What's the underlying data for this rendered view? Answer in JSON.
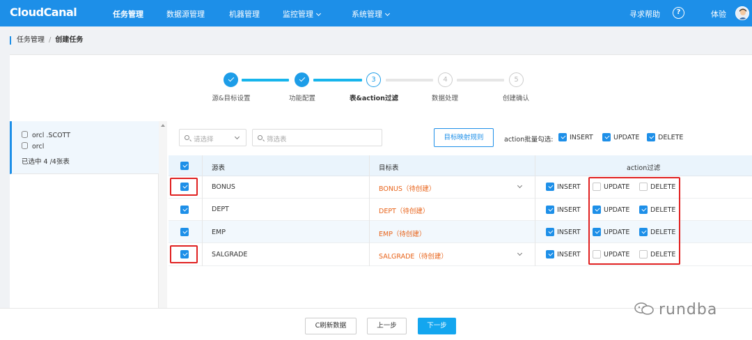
{
  "nav": {
    "logo": "CloudCanal",
    "items": [
      "任务管理",
      "数据源管理",
      "机器管理",
      "监控管理",
      "系统管理"
    ],
    "help": "寻求帮助",
    "help_icon": "?",
    "user": "体验"
  },
  "breadcrumb": {
    "parent": "任务管理",
    "separator": "/",
    "current": "创建任务"
  },
  "steps": [
    {
      "num": "1",
      "label": "源&目标设置",
      "state": "done"
    },
    {
      "num": "2",
      "label": "功能配置",
      "state": "done"
    },
    {
      "num": "3",
      "label": "表&action过滤",
      "state": "current"
    },
    {
      "num": "4",
      "label": "数据处理",
      "state": "todo"
    },
    {
      "num": "5",
      "label": "创建确认",
      "state": "todo"
    }
  ],
  "left": {
    "db1": "orcl .SCOTT",
    "db2": "orcl",
    "selected": "已选中 4 /4张表"
  },
  "toolbar": {
    "select_placeholder": "请选择",
    "filter_placeholder": "筛选表",
    "mapping_button": "目标映射规则",
    "batch_label": "action批量勾选:",
    "batch": [
      {
        "label": "INSERT",
        "checked": true
      },
      {
        "label": "UPDATE",
        "checked": true
      },
      {
        "label": "DELETE",
        "checked": true
      }
    ]
  },
  "table": {
    "headers": {
      "source": "源表",
      "target": "目标表",
      "action": "action过滤"
    },
    "rows": [
      {
        "source": "BONUS",
        "target": "BONUS（待创建）",
        "insert": true,
        "update": false,
        "delete": false
      },
      {
        "source": "DEPT",
        "target": "DEPT（待创建）",
        "insert": true,
        "update": true,
        "delete": true
      },
      {
        "source": "EMP",
        "target": "EMP（待创建）",
        "insert": true,
        "update": true,
        "delete": true
      },
      {
        "source": "SALGRADE",
        "target": "SALGRADE（待创建）",
        "insert": true,
        "update": false,
        "delete": false
      }
    ],
    "action_labels": {
      "insert": "INSERT",
      "update": "UPDATE",
      "delete": "DELETE"
    }
  },
  "footer": {
    "refresh": "C刷新数据",
    "prev": "上一步",
    "next": "下一步"
  },
  "watermark": "rundba",
  "colors": {
    "primary": "#1d8fe8",
    "accent": "#13a6ef",
    "target_text": "#e8641b",
    "highlight": "#e02020"
  }
}
